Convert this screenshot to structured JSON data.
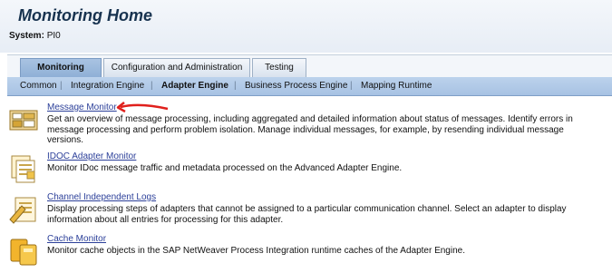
{
  "header": {
    "title": "Monitoring Home",
    "system_label": "System:",
    "system_value": "PI0"
  },
  "tabs": [
    {
      "label": "Monitoring",
      "active": true
    },
    {
      "label": "Configuration and Administration",
      "active": false
    },
    {
      "label": "Testing",
      "active": false
    }
  ],
  "subnav": {
    "items": [
      "Common",
      "Integration Engine",
      "Adapter Engine",
      "Business Process Engine",
      "Mapping Runtime"
    ],
    "selected": "Adapter Engine",
    "separator": "|"
  },
  "items": [
    {
      "title": "Message Monitor",
      "description": "Get an overview of message processing, including aggregated and detailed information about status of messages. Identify errors in message processing and perform problem isolation. Manage individual messages, for example, by resending individual message versions.",
      "icon": "message-monitor-icon"
    },
    {
      "title": "IDOC Adapter Monitor",
      "description": "Monitor IDoc message traffic and metadata processed on the Advanced Adapter Engine.",
      "icon": "idoc-monitor-icon"
    },
    {
      "title": "Channel Independent Logs",
      "description": "Display processing steps of adapters that cannot be assigned to a particular communication channel. Select an adapter to display information about all entries for processing for this adapter.",
      "icon": "channel-logs-icon"
    },
    {
      "title": "Cache Monitor",
      "description": "Monitor cache objects in the SAP NetWeaver Process Integration runtime caches of the Adapter Engine.",
      "icon": "cache-monitor-icon"
    }
  ],
  "annotation": {
    "icon": "red-arrow-icon",
    "color": "#e0201c"
  }
}
